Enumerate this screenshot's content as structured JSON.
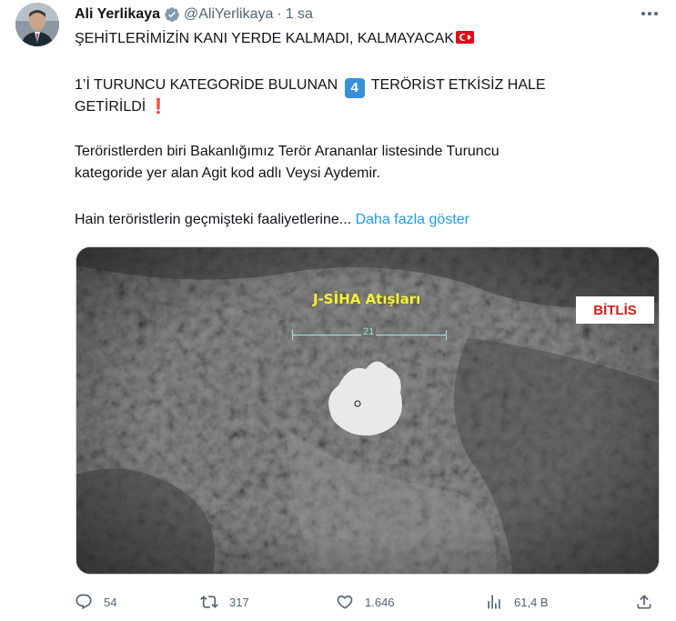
{
  "tweet": {
    "author_name": "Ali Yerlikaya",
    "handle": "@AliYerlikaya",
    "separator": "·",
    "time": "1 sa",
    "line1": "ŞEHİTLERİMİZİN KANI YERDE KALMADI, KALMAYACAK",
    "line2_before": "1’İ TURUNCU KATEGORİDE BULUNAN",
    "keycap_number": "4",
    "line2_after": "TERÖRİST ETKİSİZ HALE",
    "line3": "GETİRİLDİ",
    "line3_emoji": "❗",
    "line4": "Teröristlerden biri Bakanlığımız Terör Arananlar listesinde Turuncu",
    "line5": "kategoride yer alan Agit kod adlı Veysi Aydemir.",
    "line6": "Hain teröristlerin geçmişteki faaliyetlerine...",
    "show_more": "Daha fazla göster"
  },
  "media": {
    "overlay_label": "J-SİHA Atışları",
    "location_badge": "BİTLİS",
    "scale_number": "21"
  },
  "actions": {
    "replies": "54",
    "reposts": "317",
    "likes": "1.646",
    "views": "61,4 B"
  },
  "icons": {
    "verified": "verified-badge-icon",
    "more": "more-options-icon",
    "reply": "reply-icon",
    "repost": "repost-icon",
    "like": "heart-icon",
    "views": "views-chart-icon",
    "share": "share-icon"
  },
  "colors": {
    "link": "#1d9bf0",
    "secondary_text": "#536471",
    "verified": "#829aab",
    "flag_red": "#e30a17",
    "badge_text": "#d11b1b",
    "overlay_label": "#f5ef4a"
  }
}
